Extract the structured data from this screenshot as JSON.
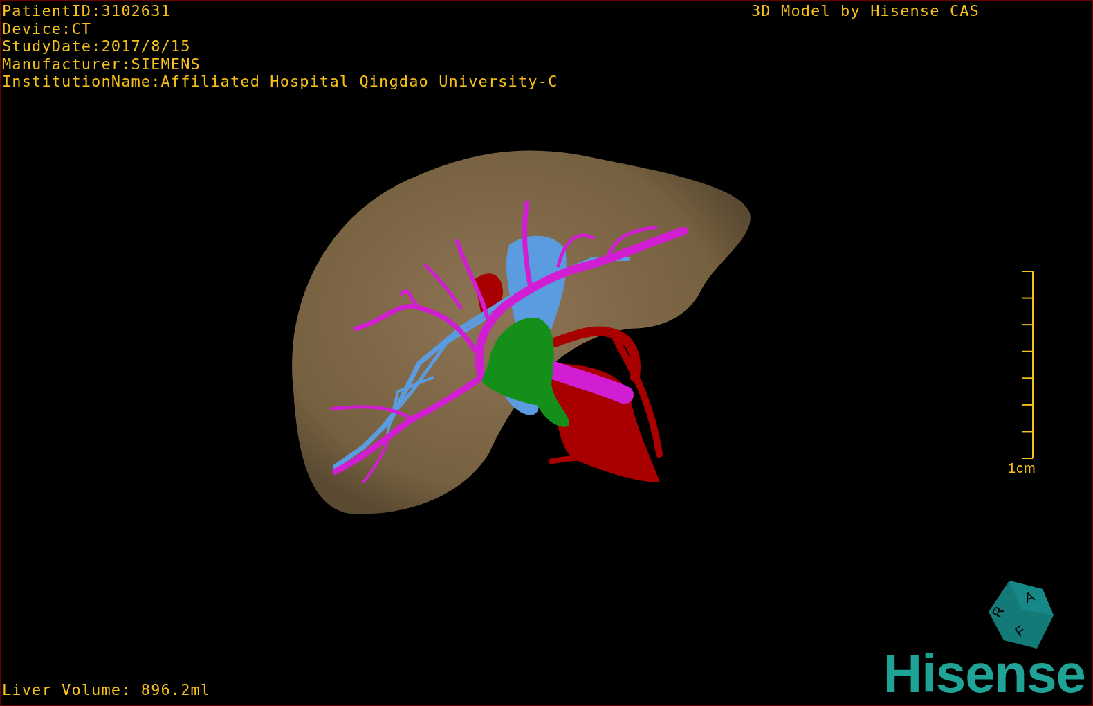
{
  "patient_info": [
    "PatientID:3102631",
    "Device:CT",
    "StudyDate:2017/8/15",
    "Manufacturer:SIEMENS",
    "InstitutionName:Affiliated Hospital Qingdao University-C"
  ],
  "title": "3D Model by Hisense CAS",
  "scale_bar": {
    "label": "1cm"
  },
  "orientation_cube": {
    "faces": [
      "R",
      "A",
      "F"
    ]
  },
  "logo": "Hisense",
  "liver_volume": "Liver Volume: 896.2ml"
}
